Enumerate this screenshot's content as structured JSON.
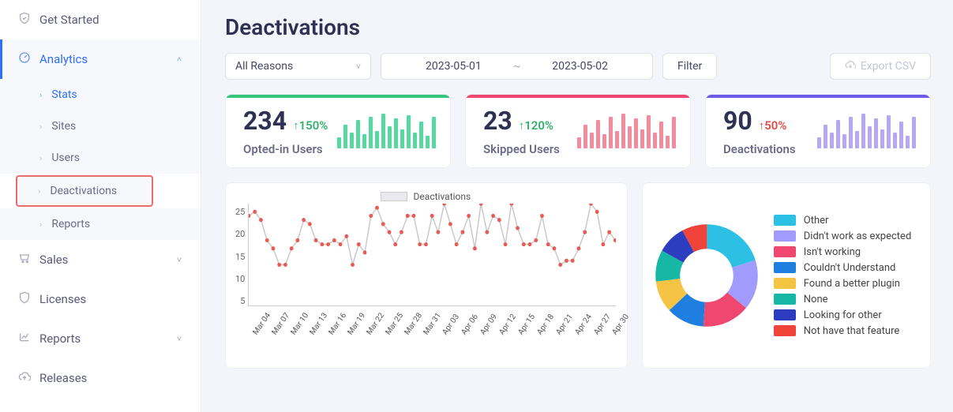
{
  "sidebar": {
    "get_started": "Get Started",
    "analytics": "Analytics",
    "sub": {
      "stats": "Stats",
      "sites": "Sites",
      "users": "Users",
      "deactivations": "Deactivations",
      "reports": "Reports"
    },
    "sales": "Sales",
    "licenses": "Licenses",
    "reports2": "Reports",
    "releases": "Releases"
  },
  "page_title": "Deactivations",
  "filters": {
    "reason": "All Reasons",
    "date_from": "2023-05-01",
    "date_to": "2023-05-02",
    "filter_btn": "Filter",
    "export_btn": "Export CSV"
  },
  "cards": [
    {
      "value": "234",
      "delta": "↑150%",
      "caption": "Opted-in Users"
    },
    {
      "value": "23",
      "delta": "↑120%",
      "caption": "Skipped Users"
    },
    {
      "value": "90",
      "delta": "↑50%",
      "caption": "Deactivations"
    }
  ],
  "spark_bars": [
    14,
    30,
    20,
    36,
    18,
    40,
    22,
    44,
    28,
    38,
    24,
    42,
    20,
    34,
    16,
    40
  ],
  "chart_data": {
    "type": "line",
    "title": "Deactivations",
    "ylabel": "",
    "xlabel": "",
    "ylim": [
      0,
      25
    ],
    "yticks": [
      5,
      10,
      15,
      20,
      25
    ],
    "categories": [
      "Mar 04",
      "Mar 07",
      "Mar 10",
      "Mar 13",
      "Mar 16",
      "Mar 19",
      "Mar 22",
      "Mar 25",
      "Mar 28",
      "Mar 31",
      "Apr 03",
      "Apr 06",
      "Apr 09",
      "Apr 12",
      "Apr 15",
      "Apr 18",
      "Apr 21",
      "Apr 24",
      "Apr 27",
      "Apr 30"
    ],
    "series": [
      {
        "name": "Deactivations",
        "values": [
          22,
          23,
          21,
          16,
          14,
          10,
          10,
          14,
          16,
          21,
          20,
          16,
          15,
          15,
          16,
          15,
          17,
          10,
          15,
          13,
          22,
          24,
          20,
          18,
          15,
          18,
          22,
          22,
          15,
          15,
          22,
          18,
          25,
          20,
          15,
          18,
          22,
          14,
          25,
          18,
          22,
          21,
          15,
          25,
          19,
          15,
          15,
          16,
          22,
          15,
          14,
          10,
          11,
          11,
          14,
          18,
          25,
          23,
          15,
          18,
          16
        ]
      }
    ]
  },
  "pie": {
    "type": "pie",
    "segments": [
      {
        "label": "Other",
        "value": 20,
        "color": "#2bc0e4"
      },
      {
        "label": "Didn't work as expected",
        "value": 16,
        "color": "#a29bfe"
      },
      {
        "label": "Isn't working",
        "value": 15,
        "color": "#ef476f"
      },
      {
        "label": "Couldn't Understand",
        "value": 12,
        "color": "#1e7fe0"
      },
      {
        "label": "Found a better plugin",
        "value": 10,
        "color": "#f6c445"
      },
      {
        "label": "None",
        "value": 10,
        "color": "#17b7a6"
      },
      {
        "label": "Looking for other",
        "value": 9,
        "color": "#2c3dbf"
      },
      {
        "label": "Not have that feature",
        "value": 8,
        "color": "#f0433a"
      }
    ]
  }
}
